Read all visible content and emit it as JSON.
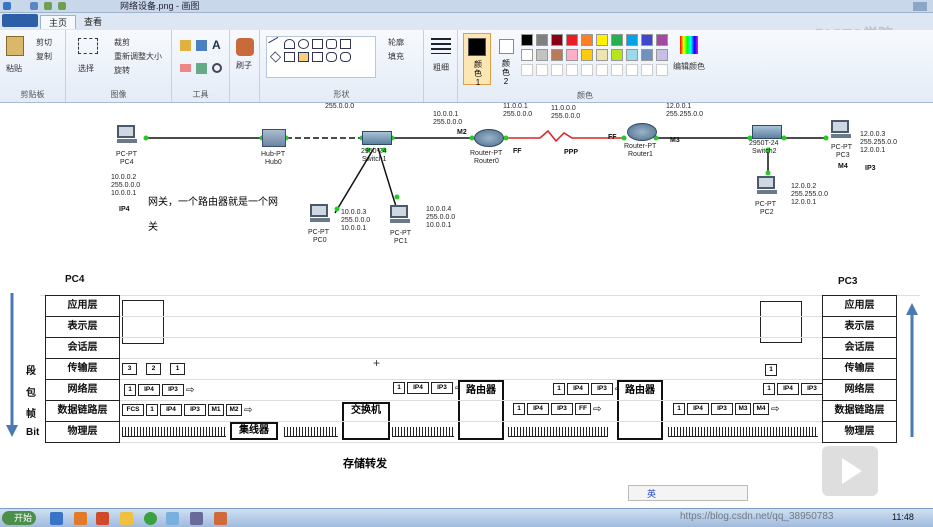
{
  "window": {
    "title": "网络设备.png - 画图"
  },
  "watermark_top": "51CTO学院",
  "tabs": [
    {
      "label": "主页"
    },
    {
      "label": "查看"
    }
  ],
  "ribbon": {
    "clipboard": {
      "paste": "粘贴",
      "cut": "剪切",
      "copy": "复制",
      "label": "剪贴板"
    },
    "image": {
      "select": "选择",
      "crop": "裁剪",
      "resize": "重新调整大小",
      "rotate": "旋转",
      "label": "图像"
    },
    "tools": {
      "label": "工具"
    },
    "brush": {
      "label": "刷子"
    },
    "shapes": {
      "outline": "轮廓",
      "fill": "填充",
      "label": "形状"
    },
    "size": {
      "label": "粗细"
    },
    "color1": "颜色 1",
    "color2": "颜色 2",
    "edit_colors": "编辑颜色",
    "colors_label": "颜色",
    "palette": [
      "#000000",
      "#7f7f7f",
      "#880015",
      "#ed1c24",
      "#ff7f27",
      "#fff200",
      "#22b14c",
      "#00a2e8",
      "#3f48cc",
      "#a349a4",
      "#ffffff",
      "#c3c3c3",
      "#b97a57",
      "#ffaec9",
      "#ffc90e",
      "#efe4b0",
      "#b5e61d",
      "#99d9ea",
      "#7092be",
      "#c8bfe7"
    ]
  },
  "topology": {
    "pc4": {
      "type": "PC-PT",
      "name": "PC4",
      "ip": "10.0.0.2\n255.0.0.0\n10.0.0.1",
      "tag": "IP4"
    },
    "hub0": {
      "type": "Hub-PT",
      "name": "Hub0"
    },
    "switch1": {
      "type": "2950-24",
      "name": "Switch1"
    },
    "pc0": {
      "type": "PC-PT",
      "name": "PC0",
      "ip": "10.0.0.3\n255.0.0.0\n10.0.0.1"
    },
    "pc1": {
      "type": "PC-PT",
      "name": "PC1",
      "ip": "10.0.0.4\n255.0.0.0\n10.0.0.1"
    },
    "router0": {
      "type": "Router-PT",
      "name": "Router0",
      "ip_left": "10.0.0.1\n255.0.0.0",
      "ip_right": "11.0.0.1\n255.0.0.0",
      "mac": "M2",
      "ff": "FF"
    },
    "router1": {
      "type": "Router-PT",
      "name": "Router1",
      "ip_left": "11.0.0.0\n255.0.0.0",
      "ip_right": "12.0.0.1\n255.255.0.0",
      "mac": "M3",
      "ff": "FF"
    },
    "top_label": "10.0.0.1\n255.0.0.0",
    "top_mid": "255.0.0.0",
    "ppp": "PPP",
    "switch2": {
      "type": "2950T-24",
      "name": "Switch2"
    },
    "pc2": {
      "type": "PC-PT",
      "name": "PC2",
      "ip": "12.0.0.2\n255.255.0.0\n12.0.0.1"
    },
    "pc3": {
      "type": "PC-PT",
      "name": "PC3",
      "ip": "12.0.0.3\n255.255.0.0\n12.0.0.1",
      "mac": "M4",
      "tag": "IP3"
    },
    "note": "网关，一个路由器就是一个网",
    "note2": "关"
  },
  "diagram": {
    "left_host": "PC4",
    "right_host": "PC3",
    "layers": [
      "应用层",
      "表示层",
      "会话层",
      "传输层",
      "网络层",
      "数据链路层",
      "物理层"
    ],
    "side_labels": [
      "段",
      "包",
      "帧",
      "Bit"
    ],
    "transport_pkts": [
      "3",
      "2",
      "1"
    ],
    "transport_right": "1",
    "net_pkt": [
      "1",
      "IP4",
      "IP3"
    ],
    "link_pkt_left": [
      "FCS",
      "1",
      "IP4",
      "IP3",
      "M1",
      "M2"
    ],
    "hub": "集线器",
    "switch": "交换机",
    "router": "路由器",
    "switch_net": [
      "1",
      "IP4",
      "IP3"
    ],
    "r1_link": [
      "1",
      "IP4",
      "IP3",
      "FF"
    ],
    "r1_net": [
      "1",
      "IP4",
      "IP3"
    ],
    "r2_link": [
      "1",
      "IP4",
      "IP3",
      "M3",
      "M4"
    ],
    "right_net": [
      "1",
      "IP4",
      "IP3"
    ],
    "store_forward": "存储转发"
  },
  "taskbar": {
    "start": "开始",
    "ime": "英",
    "url": "https://blog.csdn.net/qq_38950783",
    "time": "11:48"
  }
}
